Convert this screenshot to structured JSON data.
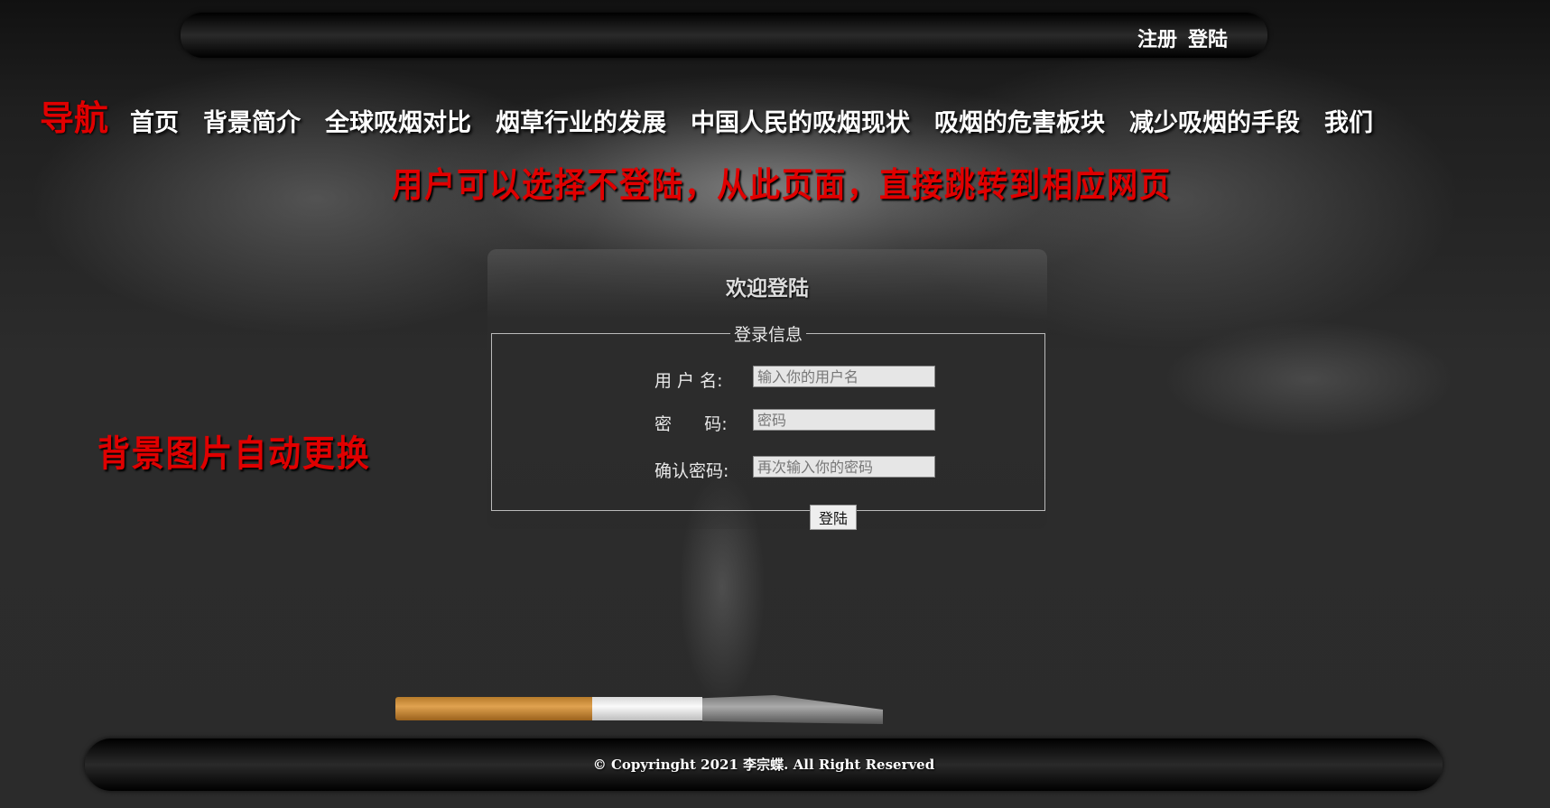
{
  "header": {
    "auth_links": [
      "注册",
      "登陆"
    ]
  },
  "nav": {
    "label": "导航",
    "items": [
      "首页",
      "背景简介",
      "全球吸烟对比",
      "烟草行业的发展",
      "中国人民的吸烟现状",
      "吸烟的危害板块",
      "减少吸烟的手段",
      "我们"
    ]
  },
  "notes": {
    "main": "用户可以选择不登陆，从此页面，直接跳转到相应网页",
    "background": "背景图片自动更换"
  },
  "login": {
    "title": "欢迎登陆",
    "legend": "登录信息",
    "fields": [
      {
        "label": "用 户 名:",
        "placeholder": "输入你的用户名",
        "value": ""
      },
      {
        "label": "密      码:",
        "placeholder": "密码",
        "value": ""
      },
      {
        "label": "确认密码:",
        "placeholder": "再次输入你的密码",
        "value": ""
      }
    ],
    "submit_label": "登陆"
  },
  "footer": {
    "copyright": "© Copyringht 2021 李宗蝶. All Right Reserved"
  },
  "colors": {
    "accent_red": "#e00000",
    "background": "#2b2b2b"
  }
}
